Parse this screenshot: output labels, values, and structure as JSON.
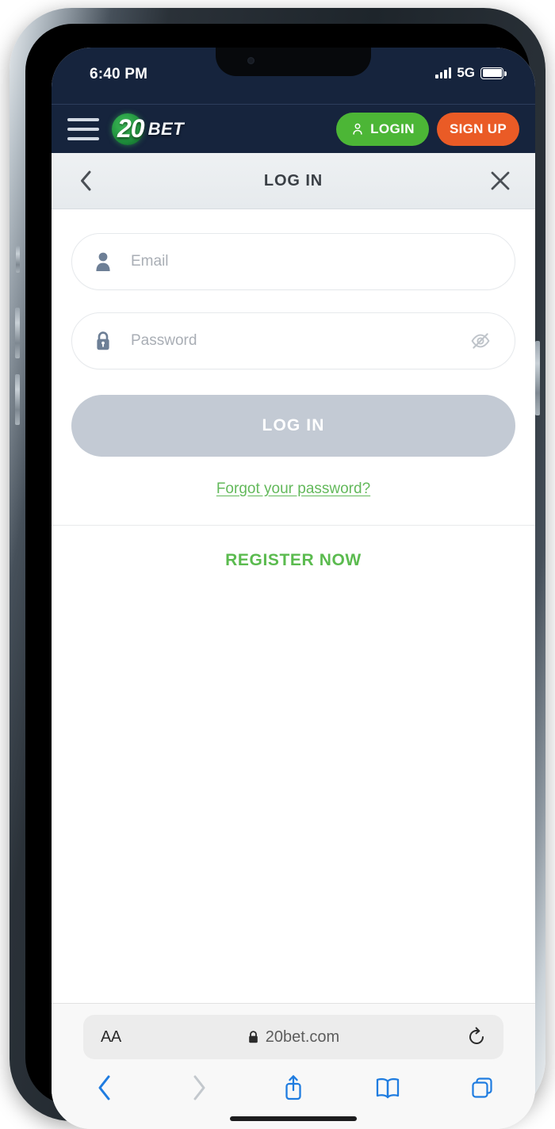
{
  "status_bar": {
    "time": "6:40 PM",
    "network": "5G",
    "signal_icon": "signal-bars-icon",
    "battery_icon": "battery-full-icon"
  },
  "site_header": {
    "menu_icon": "hamburger-menu-icon",
    "logo": {
      "primary": "20",
      "secondary": "BET"
    },
    "login_button": {
      "label": "LOGIN",
      "icon": "user-icon",
      "color": "#4cb636"
    },
    "signup_button": {
      "label": "SIGN UP",
      "color": "#ea5b26"
    },
    "background_color": "#16243d"
  },
  "modal": {
    "title": "LOG IN",
    "back_icon": "chevron-left-icon",
    "close_icon": "close-x-icon"
  },
  "form": {
    "email": {
      "placeholder": "Email",
      "value": "",
      "icon": "user-avatar-icon"
    },
    "password": {
      "placeholder": "Password",
      "value": "",
      "icon": "lock-icon",
      "toggle_icon": "eye-off-icon"
    },
    "submit_button": {
      "label": "LOG IN",
      "enabled": false,
      "color": "#c3cad4"
    },
    "forgot_link": {
      "label": "Forgot your password?",
      "color": "#63b95b"
    },
    "register_link": {
      "label": "REGISTER NOW",
      "color": "#5bbb4f"
    }
  },
  "browser": {
    "text_size_button": "AA",
    "lock_icon": "lock-icon",
    "url": "20bet.com",
    "reload_icon": "reload-icon",
    "toolbar": [
      {
        "name": "back",
        "icon": "chevron-left-icon",
        "enabled": true
      },
      {
        "name": "forward",
        "icon": "chevron-right-icon",
        "enabled": false
      },
      {
        "name": "share",
        "icon": "share-icon",
        "enabled": true
      },
      {
        "name": "bookmarks",
        "icon": "book-icon",
        "enabled": true
      },
      {
        "name": "tabs",
        "icon": "tabs-icon",
        "enabled": true
      }
    ]
  }
}
